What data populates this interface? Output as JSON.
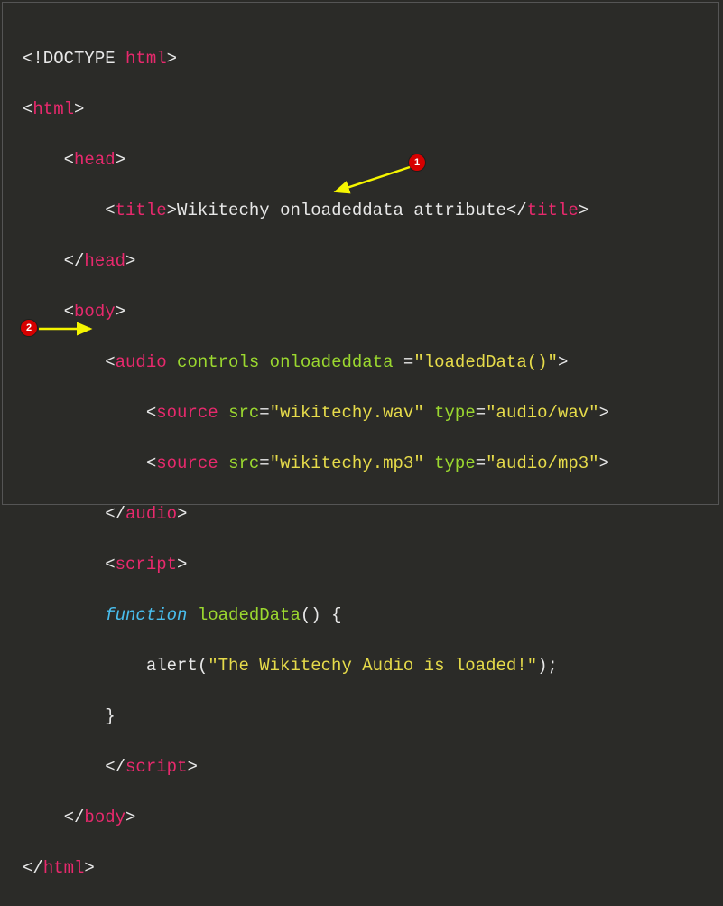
{
  "badges": {
    "b1": "1",
    "b2": "2"
  },
  "code": {
    "l1_doctype": "<!DOCTYPE ",
    "l1_html": "html",
    "l1_end": ">",
    "l2_open": "<",
    "l2_tag": "html",
    "l2_end": ">",
    "l3_open": "<",
    "l3_tag": "head",
    "l3_end": ">",
    "l4_open": "<",
    "l4_tag": "title",
    "l4_end": ">",
    "l4_text": "Wikitechy onloadeddata attribute",
    "l4_open2": "</",
    "l4_tag2": "title",
    "l4_end2": ">",
    "l5_open": "</",
    "l5_tag": "head",
    "l5_end": ">",
    "l6_open": "<",
    "l6_tag": "body",
    "l6_end": ">",
    "l7_open": "<",
    "l7_tag": "audio",
    "l7_sp": " ",
    "l7_attr1": "controls",
    "l7_sp2": " ",
    "l7_attr2": "onloadeddata ",
    "l7_eq": "=",
    "l7_val": "\"loadedData()\"",
    "l7_end": ">",
    "l8_open": "<",
    "l8_tag": "source",
    "l8_sp": " ",
    "l8_attr1": "src",
    "l8_eq1": "=",
    "l8_val1": "\"wikitechy.wav\"",
    "l8_sp2": " ",
    "l8_attr2": "type",
    "l8_eq2": "=",
    "l8_val2": "\"audio/wav\"",
    "l8_end": ">",
    "l9_open": "<",
    "l9_tag": "source",
    "l9_sp": " ",
    "l9_attr1": "src",
    "l9_eq1": "=",
    "l9_val1": "\"wikitechy.mp3\"",
    "l9_sp2": " ",
    "l9_attr2": "type",
    "l9_eq2": "=",
    "l9_val2": "\"audio/mp3\"",
    "l9_end": ">",
    "l10_open": "</",
    "l10_tag": "audio",
    "l10_end": ">",
    "l11_open": "<",
    "l11_tag": "script",
    "l11_end": ">",
    "l12_kw": "function",
    "l12_sp": " ",
    "l12_fn": "loadedData",
    "l12_rest": "() {",
    "l13_call": "            alert(",
    "l13_str": "\"The Wikitechy Audio is loaded!\"",
    "l13_rest": ");",
    "l14": "        }",
    "l15_open": "</",
    "l15_tag": "script",
    "l15_end": ">",
    "l16_open": "</",
    "l16_tag": "body",
    "l16_end": ">",
    "l17_open": "</",
    "l17_tag": "html",
    "l17_end": ">"
  }
}
